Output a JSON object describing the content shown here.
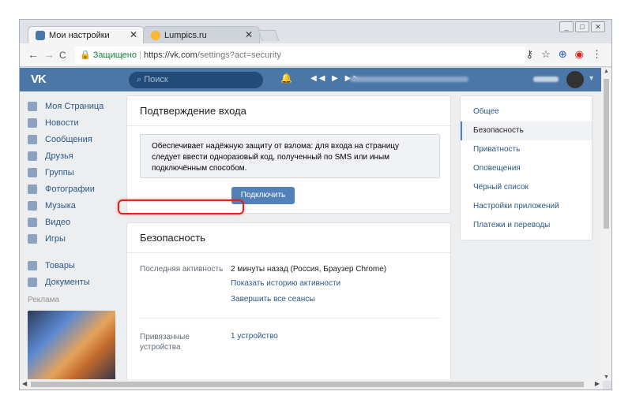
{
  "browser": {
    "tabs": [
      {
        "title": "Мои настройки",
        "favicon": "vk-icon",
        "close": "✕"
      },
      {
        "title": "Lumpics.ru",
        "favicon": "lumpics-icon",
        "close": "✕"
      }
    ],
    "back": "←",
    "forward": "→",
    "reload": "C",
    "secure_label": "Защищено",
    "url_host": "https://vk.com",
    "url_path": "/settings?act=security",
    "window_buttons": [
      "_",
      "□",
      "✕"
    ]
  },
  "vk_header": {
    "logo": "VK",
    "search_placeholder": "Поиск",
    "player_controls": "◀◀ ▶ ▶▶"
  },
  "left_nav": {
    "items": [
      {
        "label": "Моя Страница",
        "icon": "home-icon"
      },
      {
        "label": "Новости",
        "icon": "news-icon"
      },
      {
        "label": "Сообщения",
        "icon": "messages-icon"
      },
      {
        "label": "Друзья",
        "icon": "friends-icon"
      },
      {
        "label": "Группы",
        "icon": "groups-icon"
      },
      {
        "label": "Фотографии",
        "icon": "camera-icon"
      },
      {
        "label": "Музыка",
        "icon": "music-icon"
      },
      {
        "label": "Видео",
        "icon": "video-icon"
      },
      {
        "label": "Игры",
        "icon": "games-icon"
      }
    ],
    "items2": [
      {
        "label": "Товары",
        "icon": "goods-icon"
      },
      {
        "label": "Документы",
        "icon": "documents-icon"
      }
    ],
    "ads_label": "Реклама"
  },
  "login_confirm": {
    "title": "Подтверждение входа",
    "info": "Обеспечивает надёжную защиту от взлома: для входа на страницу следует ввести одноразовый код, полученный по SMS или иным подключённым способом.",
    "button": "Подключить"
  },
  "security": {
    "title": "Безопасность",
    "last_activity_label": "Последняя активность",
    "last_activity_value": "2 минуты назад (Россия, Браузер Chrome)",
    "show_history_link": "Показать историю активности",
    "end_sessions_link": "Завершить все сеансы",
    "devices_label": "Привязанные устройства",
    "devices_value": "1 устройство"
  },
  "right_menu": {
    "items": [
      {
        "label": "Общее",
        "selected": false
      },
      {
        "label": "Безопасность",
        "selected": true
      },
      {
        "label": "Приватность",
        "selected": false
      },
      {
        "label": "Оповещения",
        "selected": false
      },
      {
        "label": "Чёрный список",
        "selected": false
      },
      {
        "label": "Настройки приложений",
        "selected": false
      },
      {
        "label": "Платежи и переводы",
        "selected": false
      }
    ]
  },
  "colors": {
    "vk_blue": "#4a76a8",
    "link": "#2a5885",
    "highlight_red": "#e2231a"
  }
}
